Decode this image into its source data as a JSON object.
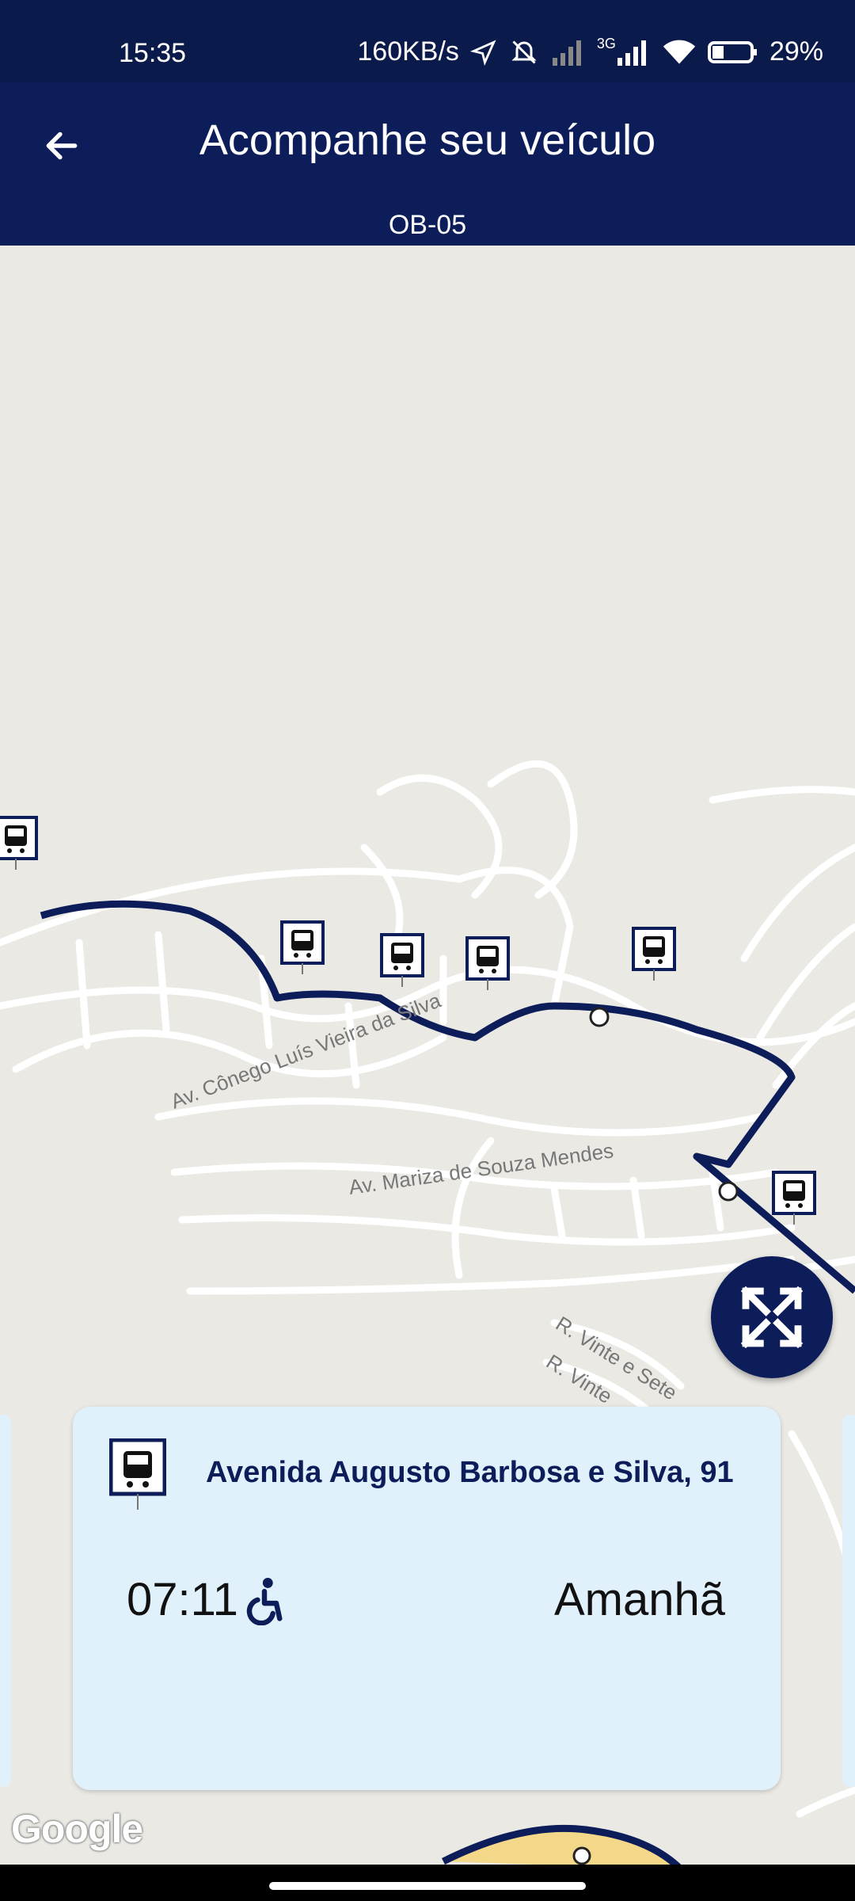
{
  "status_bar": {
    "time": "15:35",
    "network_speed": "160KB/s",
    "network_type": "3G",
    "battery": "29%",
    "icons": [
      "location-arrow-icon",
      "mute-icon",
      "signal-icon",
      "signal-icon",
      "wifi-icon",
      "battery-icon"
    ]
  },
  "app_bar": {
    "title": "Acompanhe seu veículo",
    "back_icon": "arrow-left-icon"
  },
  "route": {
    "code": "OB-05"
  },
  "map": {
    "street_labels": [
      "Av. Cônego Luís Vieira da Silva",
      "Av. Mariza de Souza Mendes",
      "R. Vinte e Sete",
      "R. Vinte"
    ],
    "attribution": "Google",
    "route_color": "#0c1d5a",
    "fab_icon": "expand-icon"
  },
  "stop_card": {
    "icon": "bus-stop-icon",
    "address": "Avenida Augusto Barbosa e Silva, 91",
    "time": "07:11",
    "accessibility_icon": "wheelchair-icon",
    "day": "Amanhã"
  }
}
